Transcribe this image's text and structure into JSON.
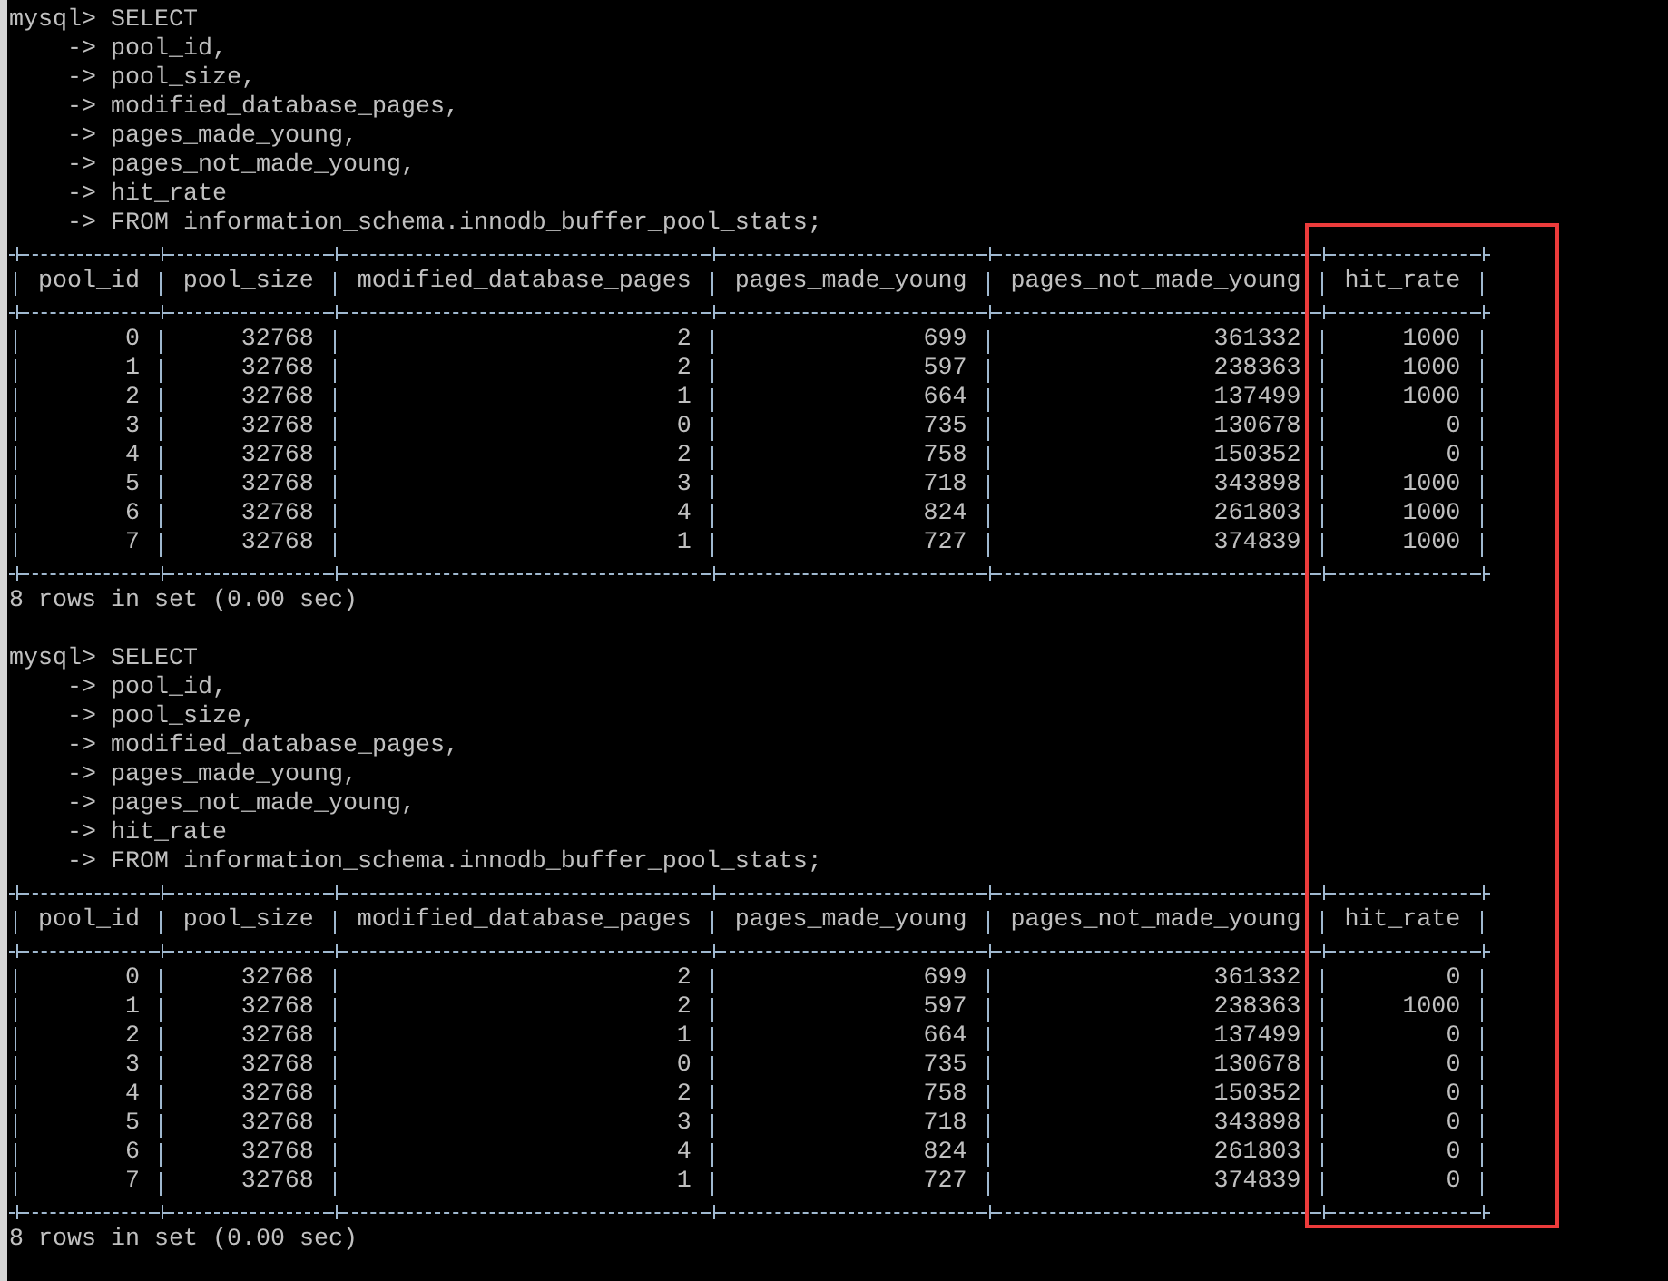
{
  "queries": [
    {
      "lines": [
        "mysql> SELECT",
        "    -> pool_id,",
        "    -> pool_size,",
        "    -> modified_database_pages,",
        "    -> pages_made_young,",
        "    -> pages_not_made_young,",
        "    -> hit_rate",
        "    -> FROM information_schema.innodb_buffer_pool_stats;"
      ],
      "columns": [
        "pool_id",
        "pool_size",
        "modified_database_pages",
        "pages_made_young",
        "pages_not_made_young",
        "hit_rate"
      ],
      "rows": [
        [
          "0",
          "32768",
          "2",
          "699",
          "361332",
          "1000"
        ],
        [
          "1",
          "32768",
          "2",
          "597",
          "238363",
          "1000"
        ],
        [
          "2",
          "32768",
          "1",
          "664",
          "137499",
          "1000"
        ],
        [
          "3",
          "32768",
          "0",
          "735",
          "130678",
          "0"
        ],
        [
          "4",
          "32768",
          "2",
          "758",
          "150352",
          "0"
        ],
        [
          "5",
          "32768",
          "3",
          "718",
          "343898",
          "1000"
        ],
        [
          "6",
          "32768",
          "4",
          "824",
          "261803",
          "1000"
        ],
        [
          "7",
          "32768",
          "1",
          "727",
          "374839",
          "1000"
        ]
      ],
      "footer": "8 rows in set (0.00 sec)"
    },
    {
      "lines": [
        "mysql> SELECT",
        "    -> pool_id,",
        "    -> pool_size,",
        "    -> modified_database_pages,",
        "    -> pages_made_young,",
        "    -> pages_not_made_young,",
        "    -> hit_rate",
        "    -> FROM information_schema.innodb_buffer_pool_stats;"
      ],
      "columns": [
        "pool_id",
        "pool_size",
        "modified_database_pages",
        "pages_made_young",
        "pages_not_made_young",
        "hit_rate"
      ],
      "rows": [
        [
          "0",
          "32768",
          "2",
          "699",
          "361332",
          "0"
        ],
        [
          "1",
          "32768",
          "2",
          "597",
          "238363",
          "1000"
        ],
        [
          "2",
          "32768",
          "1",
          "664",
          "137499",
          "0"
        ],
        [
          "3",
          "32768",
          "0",
          "735",
          "130678",
          "0"
        ],
        [
          "4",
          "32768",
          "2",
          "758",
          "150352",
          "0"
        ],
        [
          "5",
          "32768",
          "3",
          "718",
          "343898",
          "0"
        ],
        [
          "6",
          "32768",
          "4",
          "824",
          "261803",
          "0"
        ],
        [
          "7",
          "32768",
          "1",
          "727",
          "374839",
          "0"
        ]
      ],
      "footer": "8 rows in set (0.00 sec)"
    }
  ],
  "highlight_box": true
}
